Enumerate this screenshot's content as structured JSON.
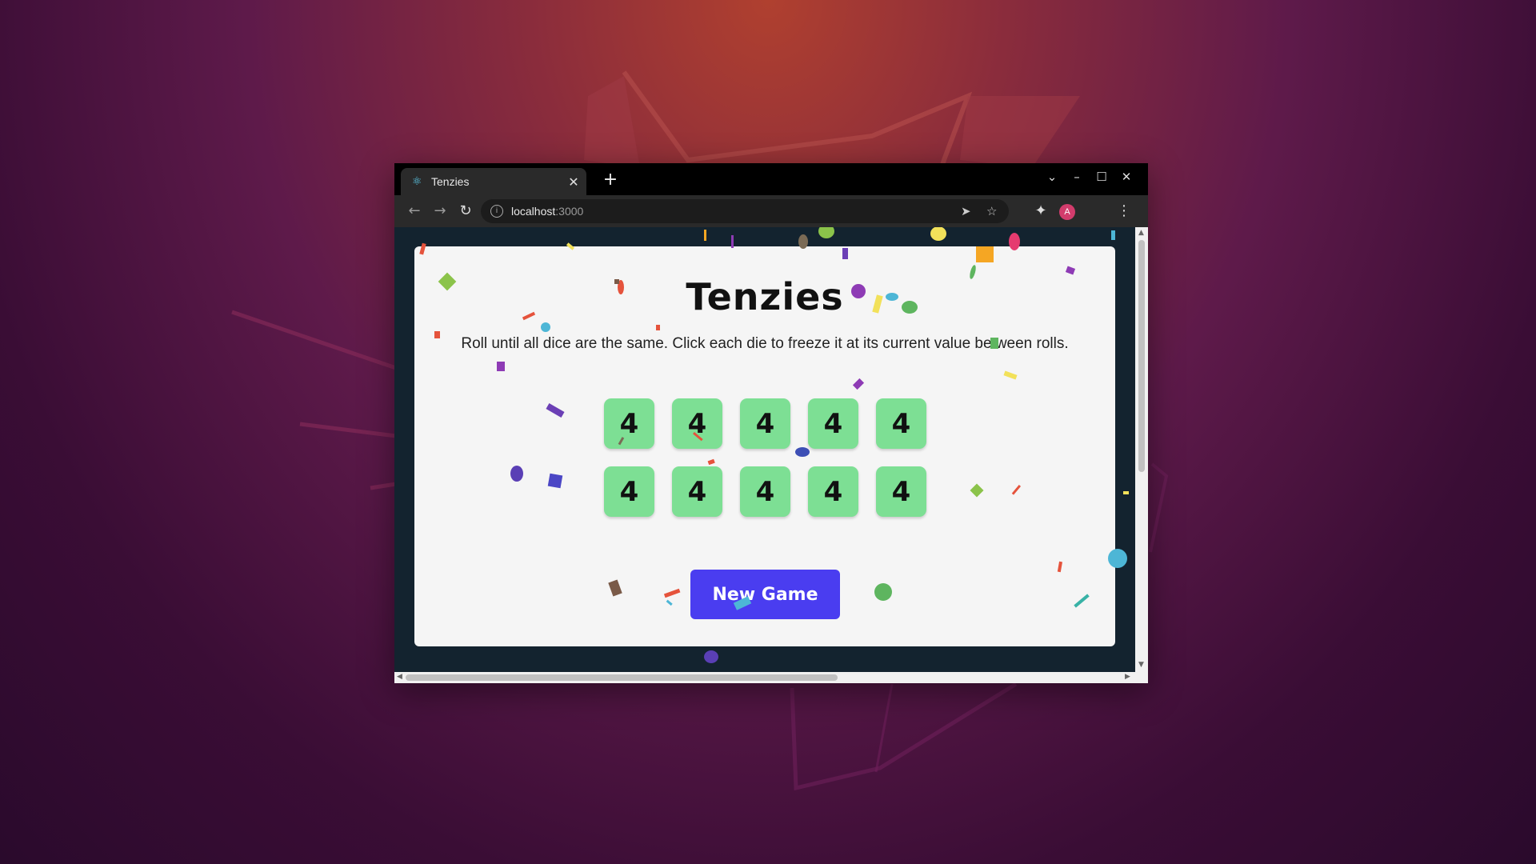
{
  "browser": {
    "tab_title": "Tenzies",
    "url_host": "localhost",
    "url_port": ":3000",
    "avatar_letter": "A"
  },
  "game": {
    "title": "Tenzies",
    "instructions": "Roll until all dice are the same. Click each die to freeze it at its current value between rolls.",
    "dice": [
      "4",
      "4",
      "4",
      "4",
      "4",
      "4",
      "4",
      "4",
      "4",
      "4"
    ],
    "button_label": "New Game"
  },
  "colors": {
    "die_held": "#7ddf94",
    "button": "#4a3df0",
    "card": "#f5f5f5"
  }
}
